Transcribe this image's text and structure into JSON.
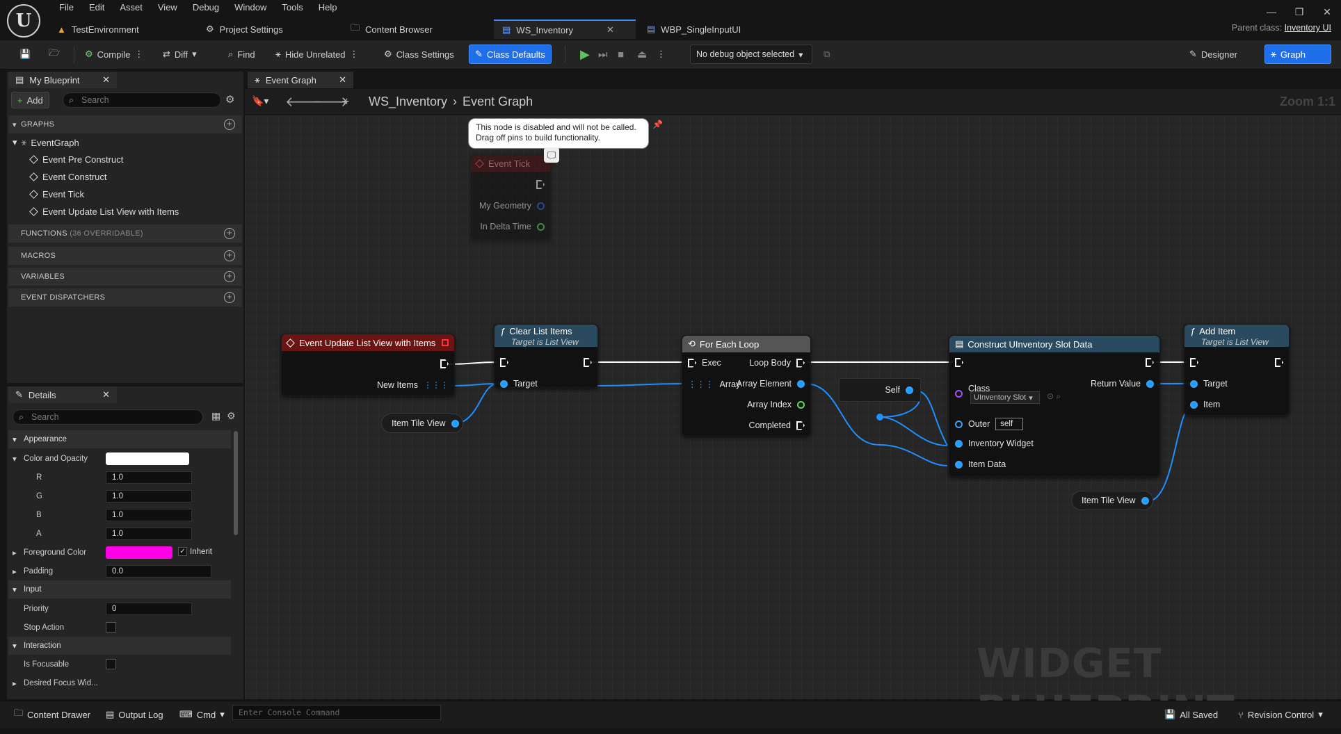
{
  "menu": [
    "File",
    "Edit",
    "Asset",
    "View",
    "Debug",
    "Window",
    "Tools",
    "Help"
  ],
  "tabs": [
    {
      "label": "TestEnvironment",
      "icon": "warning-icon"
    },
    {
      "label": "Project Settings",
      "icon": "gear-icon"
    },
    {
      "label": "Content Browser",
      "icon": "folder-icon"
    },
    {
      "label": "WS_Inventory",
      "icon": "widget-blueprint-icon",
      "active": true
    },
    {
      "label": "WBP_SingleInputUI",
      "icon": "widget-blueprint-icon"
    }
  ],
  "parent_class": {
    "label": "Parent class:",
    "value": "Inventory UI"
  },
  "toolbar": {
    "compile": "Compile",
    "diff": "Diff",
    "find": "Find",
    "hide_unrelated": "Hide Unrelated",
    "class_settings": "Class Settings",
    "class_defaults": "Class Defaults",
    "debug_select": "No debug object selected",
    "designer": "Designer",
    "graph": "Graph"
  },
  "my_blueprint": {
    "tab": "My Blueprint",
    "add": "Add",
    "search_placeholder": "Search",
    "sections": {
      "graphs": "GRAPHS",
      "functions": "FUNCTIONS",
      "functions_count": "(36 OVERRIDABLE)",
      "macros": "MACROS",
      "variables": "VARIABLES",
      "dispatchers": "EVENT DISPATCHERS"
    },
    "eventgraph": "EventGraph",
    "events": [
      "Event Pre Construct",
      "Event Construct",
      "Event Tick",
      "Event Update List View with Items"
    ]
  },
  "details": {
    "tab": "Details",
    "search_placeholder": "Search",
    "appearance": "Appearance",
    "color_opacity": "Color and Opacity",
    "r_label": "R",
    "r": "1.0",
    "g_label": "G",
    "g": "1.0",
    "b_label": "B",
    "b": "1.0",
    "a_label": "A",
    "a": "1.0",
    "foreground": "Foreground Color",
    "inherit": "Inherit",
    "padding_label": "Padding",
    "padding": "0.0",
    "input": "Input",
    "priority_label": "Priority",
    "priority": "0",
    "stop_action": "Stop Action",
    "interaction": "Interaction",
    "is_focusable": "Is Focusable",
    "desired_focus": "Desired Focus Wid..."
  },
  "graph": {
    "tab": "Event Graph",
    "breadcrumb_root": "WS_Inventory",
    "breadcrumb_leaf": "Event Graph",
    "zoom": "Zoom 1:1",
    "tooltip_line1": "This node is disabled and will not be called.",
    "tooltip_line2": "Drag off pins to build functionality.",
    "event_tick": {
      "title": "Event Tick",
      "pins": [
        "My Geometry",
        "In Delta Time"
      ]
    },
    "event_update": {
      "title": "Event Update List View with Items",
      "pin": "New Items"
    },
    "clear_list": {
      "title": "Clear List Items",
      "sub": "Target is List View",
      "pin": "Target"
    },
    "for_each": {
      "title": "For Each Loop",
      "in_exec": "Exec",
      "in_array": "Array",
      "loop_body": "Loop Body",
      "array_element": "Array Element",
      "array_index": "Array Index",
      "completed": "Completed"
    },
    "construct": {
      "title": "Construct UInventory Slot Data",
      "class": "Class",
      "class_value": "UInventory Slot",
      "return": "Return Value",
      "outer": "Outer",
      "outer_value": "self",
      "inventory_widget": "Inventory Widget",
      "item_data": "Item Data"
    },
    "add_item": {
      "title": "Add Item",
      "sub": "Target is List View",
      "target": "Target",
      "item": "Item"
    },
    "self": "Self",
    "item_tile_view_1": "Item Tile View",
    "item_tile_view_2": "Item Tile View",
    "watermark": "WIDGET BLUEPRINT"
  },
  "bottom": {
    "content_drawer": "Content Drawer",
    "output_log": "Output Log",
    "cmd": "Cmd",
    "console_placeholder": "Enter Console Command",
    "all_saved": "All Saved",
    "revision": "Revision Control"
  },
  "colors": {
    "accent": "#1f6feb",
    "event_red": "#6b1414",
    "function_blue": "#2a4a60",
    "foreground_color": "#ff00e6",
    "color_opacity": "#ffffff"
  }
}
